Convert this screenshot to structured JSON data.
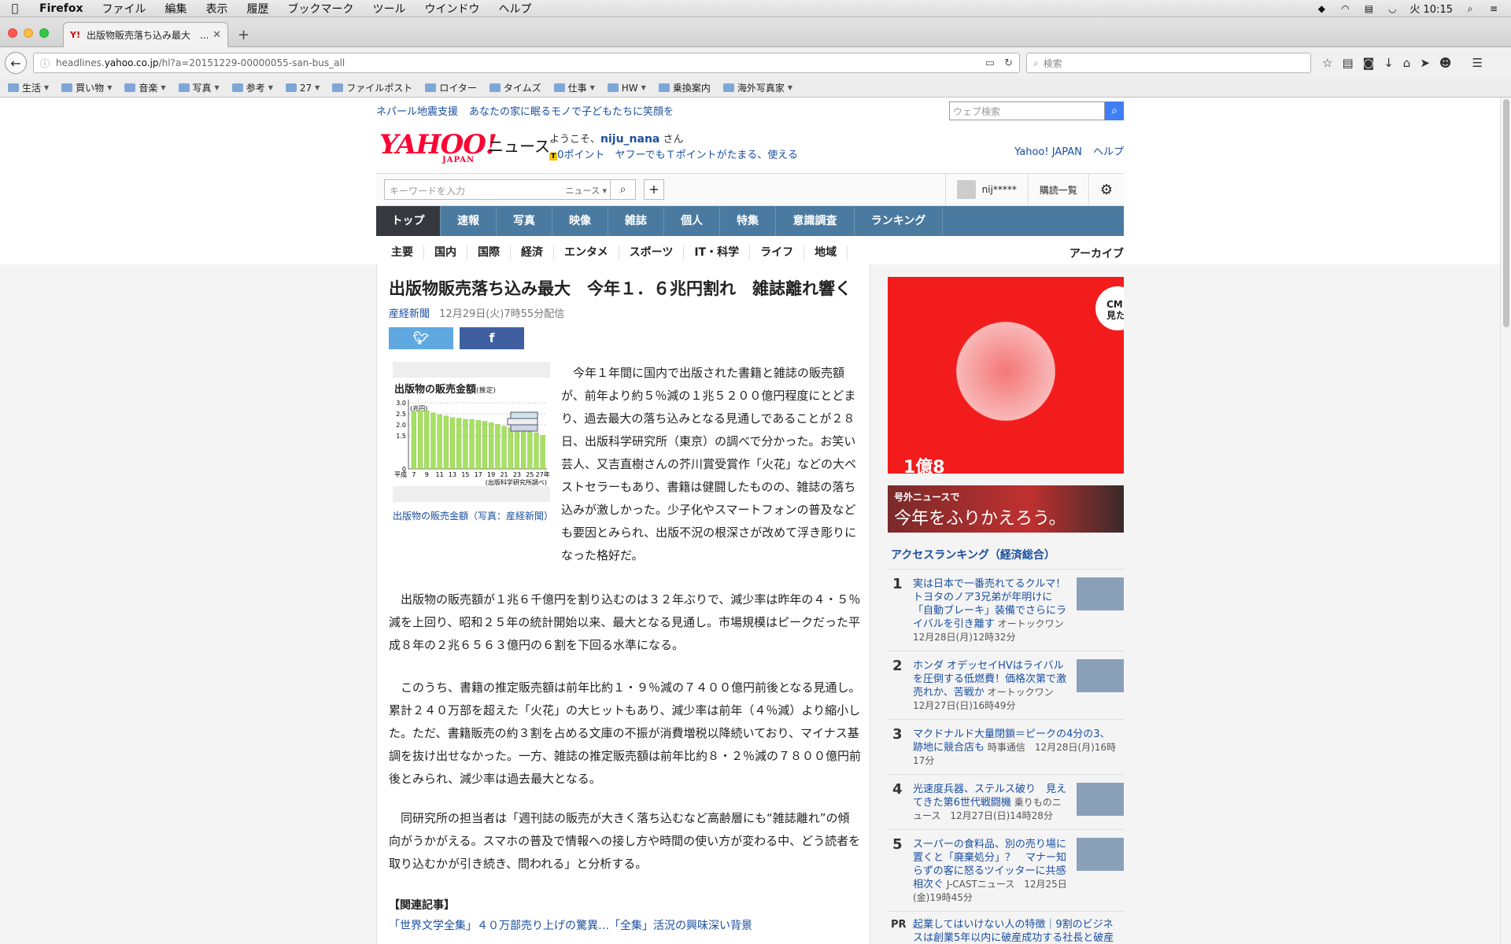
{
  "menubar": {
    "app": "Firefox",
    "items": [
      "ファイル",
      "編集",
      "表示",
      "履歴",
      "ブックマーク",
      "ツール",
      "ウインドウ",
      "ヘルプ"
    ],
    "clock": "火 10:15"
  },
  "browser": {
    "tab_title": "出版物販売落ち込み最大　...",
    "url_prefix": "headlines.",
    "url_host": "yahoo.co.jp",
    "url_path": "/hl?a=20151229-00000055-san-bus_all",
    "search_placeholder": "検索",
    "bookmarks": [
      {
        "label": "生活",
        "menu": true
      },
      {
        "label": "買い物",
        "menu": true
      },
      {
        "label": "音楽",
        "menu": true
      },
      {
        "label": "写真",
        "menu": true
      },
      {
        "label": "参考",
        "menu": true
      },
      {
        "label": "27",
        "menu": true
      },
      {
        "label": "ファイルポスト",
        "menu": false
      },
      {
        "label": "ロイター",
        "menu": false
      },
      {
        "label": "タイムズ",
        "menu": false
      },
      {
        "label": "仕事",
        "menu": true
      },
      {
        "label": "HW",
        "menu": true
      },
      {
        "label": "乗換案内",
        "menu": false
      },
      {
        "label": "海外写真家",
        "menu": true
      }
    ]
  },
  "site": {
    "top_links": [
      "ネパール地震支援",
      "あなたの家に眠るモノで子どもたちに笑顔を"
    ],
    "websearch_placeholder": "ウェブ検索",
    "logo_text": "YAHOO!",
    "logo_sub": "JAPAN",
    "section": "ニュース",
    "welcome_prefix": "ようこそ、",
    "username": "niju_nana",
    "welcome_suffix": "さん",
    "tpoint_badge": "T",
    "tpoint": "0ポイント",
    "tpoint_promo": "ヤフーでもＴポイントがたまる、使える",
    "header_links": [
      "Yahoo! JAPAN",
      "ヘルプ"
    ],
    "keyword_placeholder": "キーワードを入力",
    "keyword_scope": "ニュース",
    "account_short": "nij*****",
    "subscriptions": "購読一覧",
    "global_nav": [
      "トップ",
      "速報",
      "写真",
      "映像",
      "雑誌",
      "個人",
      "特集",
      "意識調査",
      "ランキング"
    ],
    "sub_nav": [
      "主要",
      "国内",
      "国際",
      "経済",
      "エンタメ",
      "スポーツ",
      "IT・科学",
      "ライフ",
      "地域"
    ],
    "sub_nav_active": 3,
    "archive": "アーカイブ"
  },
  "article": {
    "title": "出版物販売落ち込み最大　今年１．６兆円割れ　雑誌離れ響く",
    "source": "産経新聞",
    "date": "12月29日(火)7時55分配信",
    "paragraph1": "　今年１年間に国内で出版された書籍と雑誌の販売額が、前年より約５％減の１兆５２００億円程度にとどまり、過去最大の落ち込みとなる見通しであることが２８日、出版科学研究所（東京）の調べで分かった。お笑い芸人、又吉直樹さんの芥川賞受賞作「火花」などの大ベストセラーもあり、書籍は健闘したものの、雑誌の落ち込みが激しかった。少子化やスマートフォンの普及なども要因とみられ、出版不況の根深さが改めて浮き彫りになった格好だ。",
    "paragraph2": "　出版物の販売額が１兆６千億円を割り込むのは３２年ぶりで、減少率は昨年の４・５％減を上回り、昭和２５年の統計開始以来、最大となる見通し。市場規模はピークだった平成８年の２兆６５６３億円の６割を下回る水準になる。",
    "paragraph3": "　このうち、書籍の推定販売額は前年比約１・９％減の７４００億円前後となる見通し。累計２４０万部を超えた「火花」の大ヒットもあり、減少率は前年（４％減）より縮小した。ただ、書籍販売の約３割を占める文庫の不振が消費増税以降続いており、マイナス基調を抜け出せなかった。一方、雑誌の推定販売額は前年比約８・２％減の７８００億円前後とみられ、減少率は過去最大となる。",
    "paragraph4": "　同研究所の担当者は「週刊誌の販売が大きく落ち込むなど高齢層にも“雑誌離れ”の傾向がうかがえる。スマホの普及で情報への接し方や時間の使い方が変わる中、どう読者を取り込むかが引き続き、問われる」と分析する。",
    "related_label": "【関連記事】",
    "related_link": "「世界文学全集」４０万部売り上げの驚異…「全集」活況の興味深い背景",
    "figure_caption": "出版物の販売金額（写真：産経新聞）"
  },
  "chart_data": {
    "type": "bar",
    "title": "出版物の販売金額",
    "title_note": "(推定)",
    "unit": "(兆円)",
    "source_note": "(出版科学研究所調べ)",
    "xprefix": "平成",
    "ylim": [
      0,
      3.0
    ],
    "yticks": [
      "3.0",
      "2.5",
      "2.0",
      "1.5",
      "0"
    ],
    "xtick_labels": [
      "7",
      "9",
      "11",
      "13",
      "15",
      "17",
      "19",
      "21",
      "23",
      "25",
      "27年"
    ],
    "categories": [
      "7",
      "8",
      "9",
      "10",
      "11",
      "12",
      "13",
      "14",
      "15",
      "16",
      "17",
      "18",
      "19",
      "20",
      "21",
      "22",
      "23",
      "24",
      "25",
      "26",
      "27"
    ],
    "values": [
      2.6,
      2.66,
      2.64,
      2.54,
      2.46,
      2.4,
      2.33,
      2.3,
      2.25,
      2.24,
      2.2,
      2.16,
      2.09,
      2.02,
      1.94,
      1.87,
      1.82,
      1.76,
      1.71,
      1.64,
      1.52
    ],
    "bar_color": "#a8e063",
    "grid": true
  },
  "sidebar": {
    "ad_cm": "CM\n見た",
    "ad_bottom": "1億8",
    "banner_small": "号外ニュースで",
    "banner_big": "今年をふりかえろう。",
    "ranking_title": "アクセスランキング（経済総合）",
    "ranking": [
      {
        "num": "1",
        "title": "実は日本で一番売れてるクルマ！トヨタのノア3兄弟が年明けに「自動ブレーキ」装備でさらにライバルを引き離す",
        "meta": "オートックワン　12月28日(月)12時32分",
        "img": true
      },
      {
        "num": "2",
        "title": "ホンダ オデッセイHVはライバルを圧倒する低燃費！価格次第で激売れか、苦戦か",
        "meta": "オートックワン　12月27日(日)16時49分",
        "img": true
      },
      {
        "num": "3",
        "title": "マクドナルド大量閉鎖＝ピークの4分の3、跡地に競合店も",
        "meta": "時事通信　12月28日(月)16時17分",
        "img": false
      },
      {
        "num": "4",
        "title": "光速度兵器、ステルス破り　見えてきた第6世代戦闘機",
        "meta": "乗りものニュース　12月27日(日)14時28分",
        "img": true
      },
      {
        "num": "5",
        "title": "スーパーの食料品、別の売り場に置くと「廃棄処分」？　マナー知らずの客に怒るツイッターに共感相次ぐ",
        "meta": "J-CASTニュース　12月25日(金)19時45分",
        "img": true
      }
    ],
    "pr_label": "PR",
    "pr_text": "起業してはいけない人の特徴｜9割のビジネスは創業5年以内に破産成功する社長と破産"
  }
}
